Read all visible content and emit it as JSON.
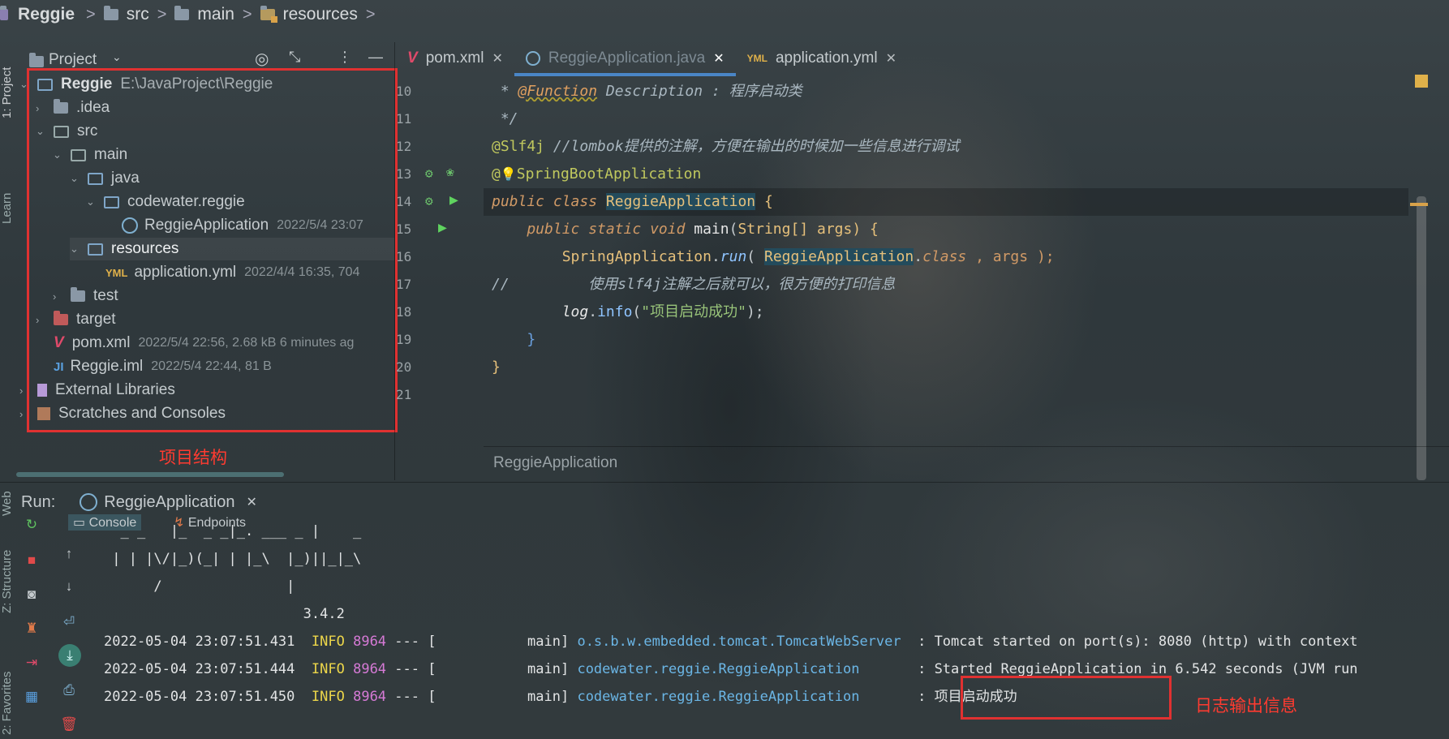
{
  "breadcrumb": [
    "Reggie",
    "src",
    "main",
    "resources"
  ],
  "leftstrip": {
    "project": "1: Project",
    "learn": "Learn",
    "web": "Web",
    "structure": "Z: Structure",
    "favorites": "2: Favorites"
  },
  "project_panel": {
    "title": "Project",
    "root": {
      "name": "Reggie",
      "path": "E:\\JavaProject\\Reggie"
    },
    "items": [
      {
        "label": ".idea",
        "meta": ""
      },
      {
        "label": "src",
        "meta": ""
      },
      {
        "label": "main",
        "meta": ""
      },
      {
        "label": "java",
        "meta": ""
      },
      {
        "label": "codewater.reggie",
        "meta": ""
      },
      {
        "label": "ReggieApplication",
        "meta": "2022/5/4 23:07"
      },
      {
        "label": "resources",
        "meta": ""
      },
      {
        "label": "application.yml",
        "meta": "2022/4/4 16:35, 704"
      },
      {
        "label": "test",
        "meta": ""
      },
      {
        "label": "target",
        "meta": ""
      },
      {
        "label": "pom.xml",
        "meta": "2022/5/4 22:56, 2.68 kB 6 minutes ag"
      },
      {
        "label": "Reggie.iml",
        "meta": "2022/5/4 22:44, 81 B"
      },
      {
        "label": "External Libraries",
        "meta": ""
      },
      {
        "label": "Scratches and Consoles",
        "meta": ""
      }
    ],
    "annotation": "项目结构"
  },
  "editor": {
    "tabs": [
      "pom.xml",
      "ReggieApplication.java",
      "application.yml"
    ],
    "line_numbers": [
      "10",
      "11",
      "12",
      "13",
      "14",
      "15",
      "16",
      "17",
      "18",
      "19",
      "20",
      "21"
    ],
    "lines": {
      "l10a": " * ",
      "l10b": "@Function",
      "l10c": " Description : 程序启动类",
      "l11": " */",
      "l12a": "@Slf4j",
      "l12b": " //lombok提供的注解，方便在输出的时候加一些信息进行调试",
      "l13a": "@",
      "l13b": "SpringBootApplication",
      "l14a": "public class ",
      "l14b": "ReggieApplication",
      "l14c": " {",
      "l15a": "    public static void ",
      "l15b": "main",
      "l15c": "(",
      "l15d": "String",
      "l15e": "[] args) {",
      "l16a": "        ",
      "l16b": "SpringApplication",
      "l16c": ".",
      "l16d": "run",
      "l16e": "( ",
      "l16f": "ReggieApplication",
      "l16g": ".",
      "l16h": "class",
      "l16i": " , args );",
      "l17a": "//",
      "l17b": "         使用slf4j注解之后就可以，很方便的打印信息",
      "l18a": "        ",
      "l18b": "log",
      "l18c": ".",
      "l18d": "info",
      "l18e": "(",
      "l18f": "\"项目启动成功\"",
      "l18g": ");",
      "l19": "    }",
      "l20": "}"
    },
    "footer": "ReggieApplication"
  },
  "run": {
    "label": "Run:",
    "config": "ReggieApplication",
    "tabs": [
      "Console",
      "Endpoints"
    ],
    "banner": [
      "  _ _   |_  _ _|_. ___ _ |    _",
      " | | |\\/|_)(_| | |_\\  |_)||_|_\\",
      "      /               |",
      "                        3.4.2"
    ],
    "logs": [
      {
        "ts": "2022-05-04 23:07:51.431",
        "level": "INFO",
        "pid": "8964",
        "mid": " --- [           main] ",
        "logger": "o.s.b.w.embedded.tomcat.TomcatWebServer",
        "msg": "  : Tomcat started on port(s): 8080 (http) with context"
      },
      {
        "ts": "2022-05-04 23:07:51.444",
        "level": "INFO",
        "pid": "8964",
        "mid": " --- [           main] ",
        "logger": "codewater.reggie.ReggieApplication",
        "msg": "       : Started ReggieApplication in 6.542 seconds (JVM run"
      },
      {
        "ts": "2022-05-04 23:07:51.450",
        "level": "INFO",
        "pid": "8964",
        "mid": " --- [           main] ",
        "logger": "codewater.reggie.ReggieApplication",
        "msg": "       : 项目启动成功"
      }
    ],
    "annotation": "日志输出信息"
  }
}
